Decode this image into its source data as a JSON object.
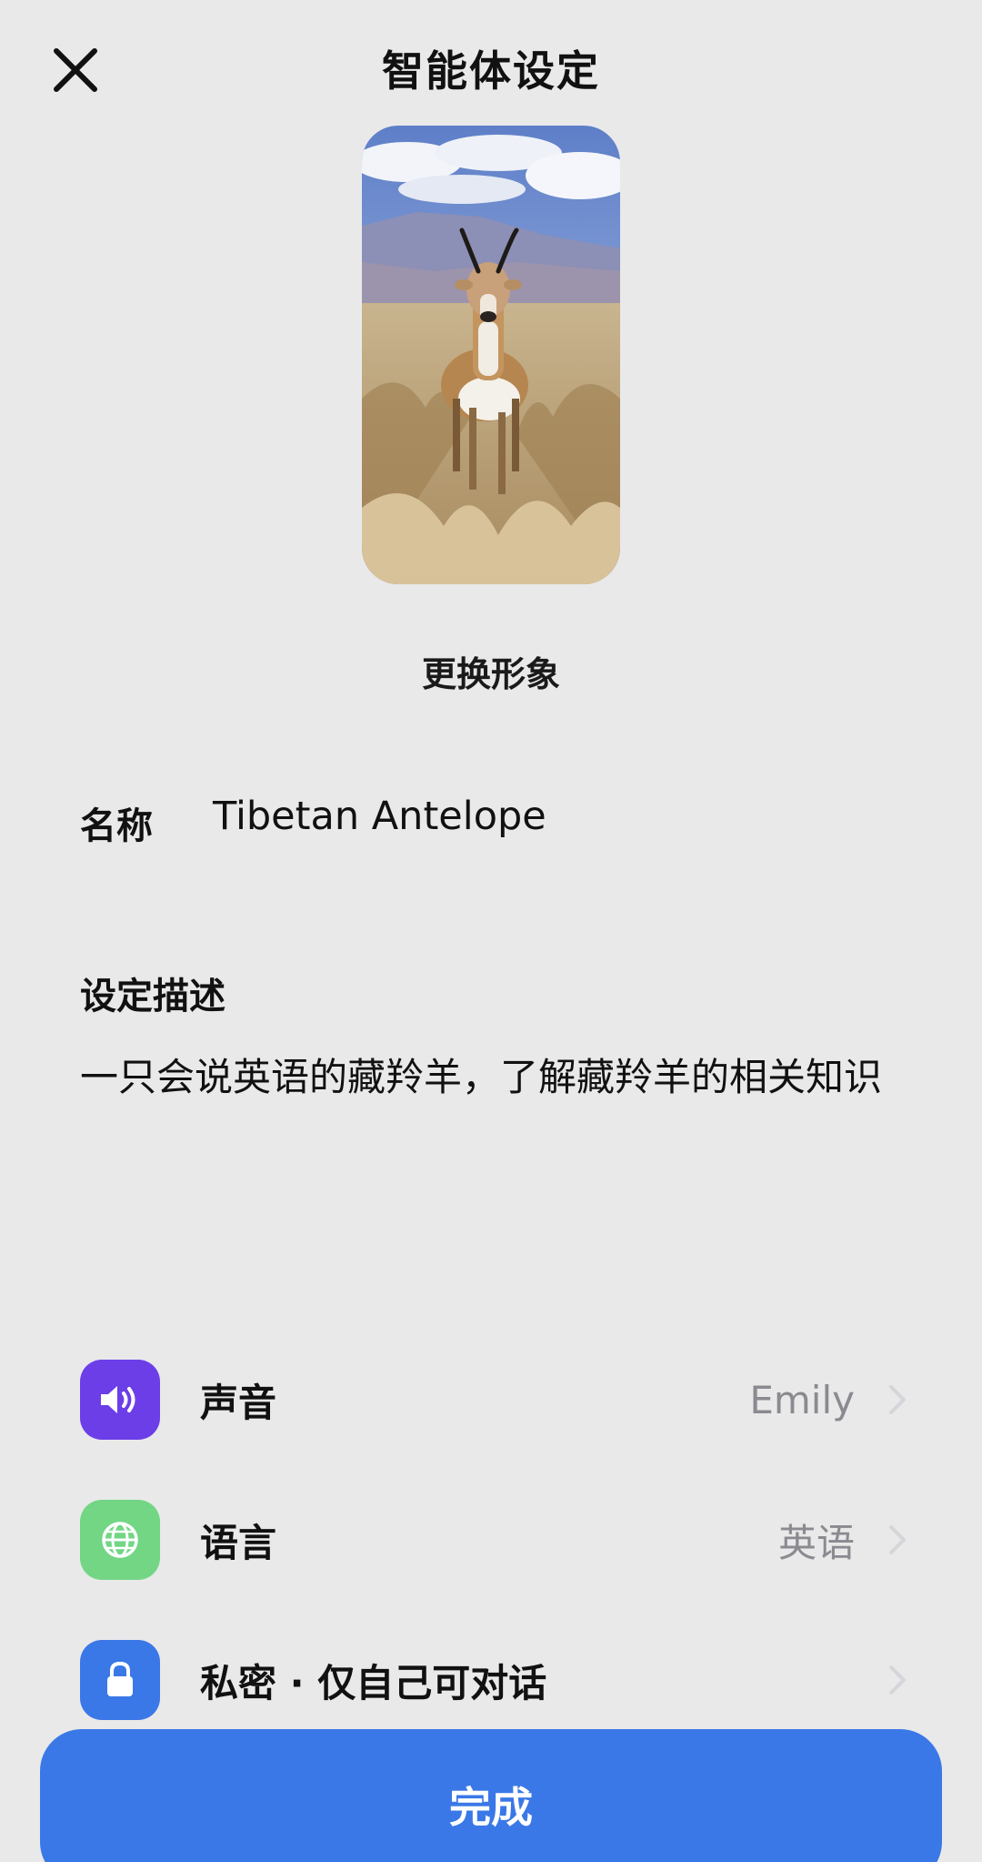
{
  "header": {
    "title": "智能体设定"
  },
  "avatar": {
    "change_label": "更换形象"
  },
  "name": {
    "label": "名称",
    "value": "Tibetan Antelope"
  },
  "description": {
    "label": "设定描述",
    "value": "一只会说英语的藏羚羊，了解藏羚羊的相关知识"
  },
  "settings": [
    {
      "label": "声音",
      "value": "Emily",
      "icon": "speaker-icon",
      "color": "#6b3ee8"
    },
    {
      "label": "语言",
      "value": "英语",
      "icon": "globe-icon",
      "color": "#72d684"
    },
    {
      "label": "私密 · 仅自己可对话",
      "value": "",
      "icon": "lock-icon",
      "color": "#3b78e7"
    }
  ],
  "footer": {
    "done_label": "完成"
  },
  "colors": {
    "background": "#e9e9ea",
    "primary": "#3b78e7",
    "muted_text": "#8a8a90"
  }
}
